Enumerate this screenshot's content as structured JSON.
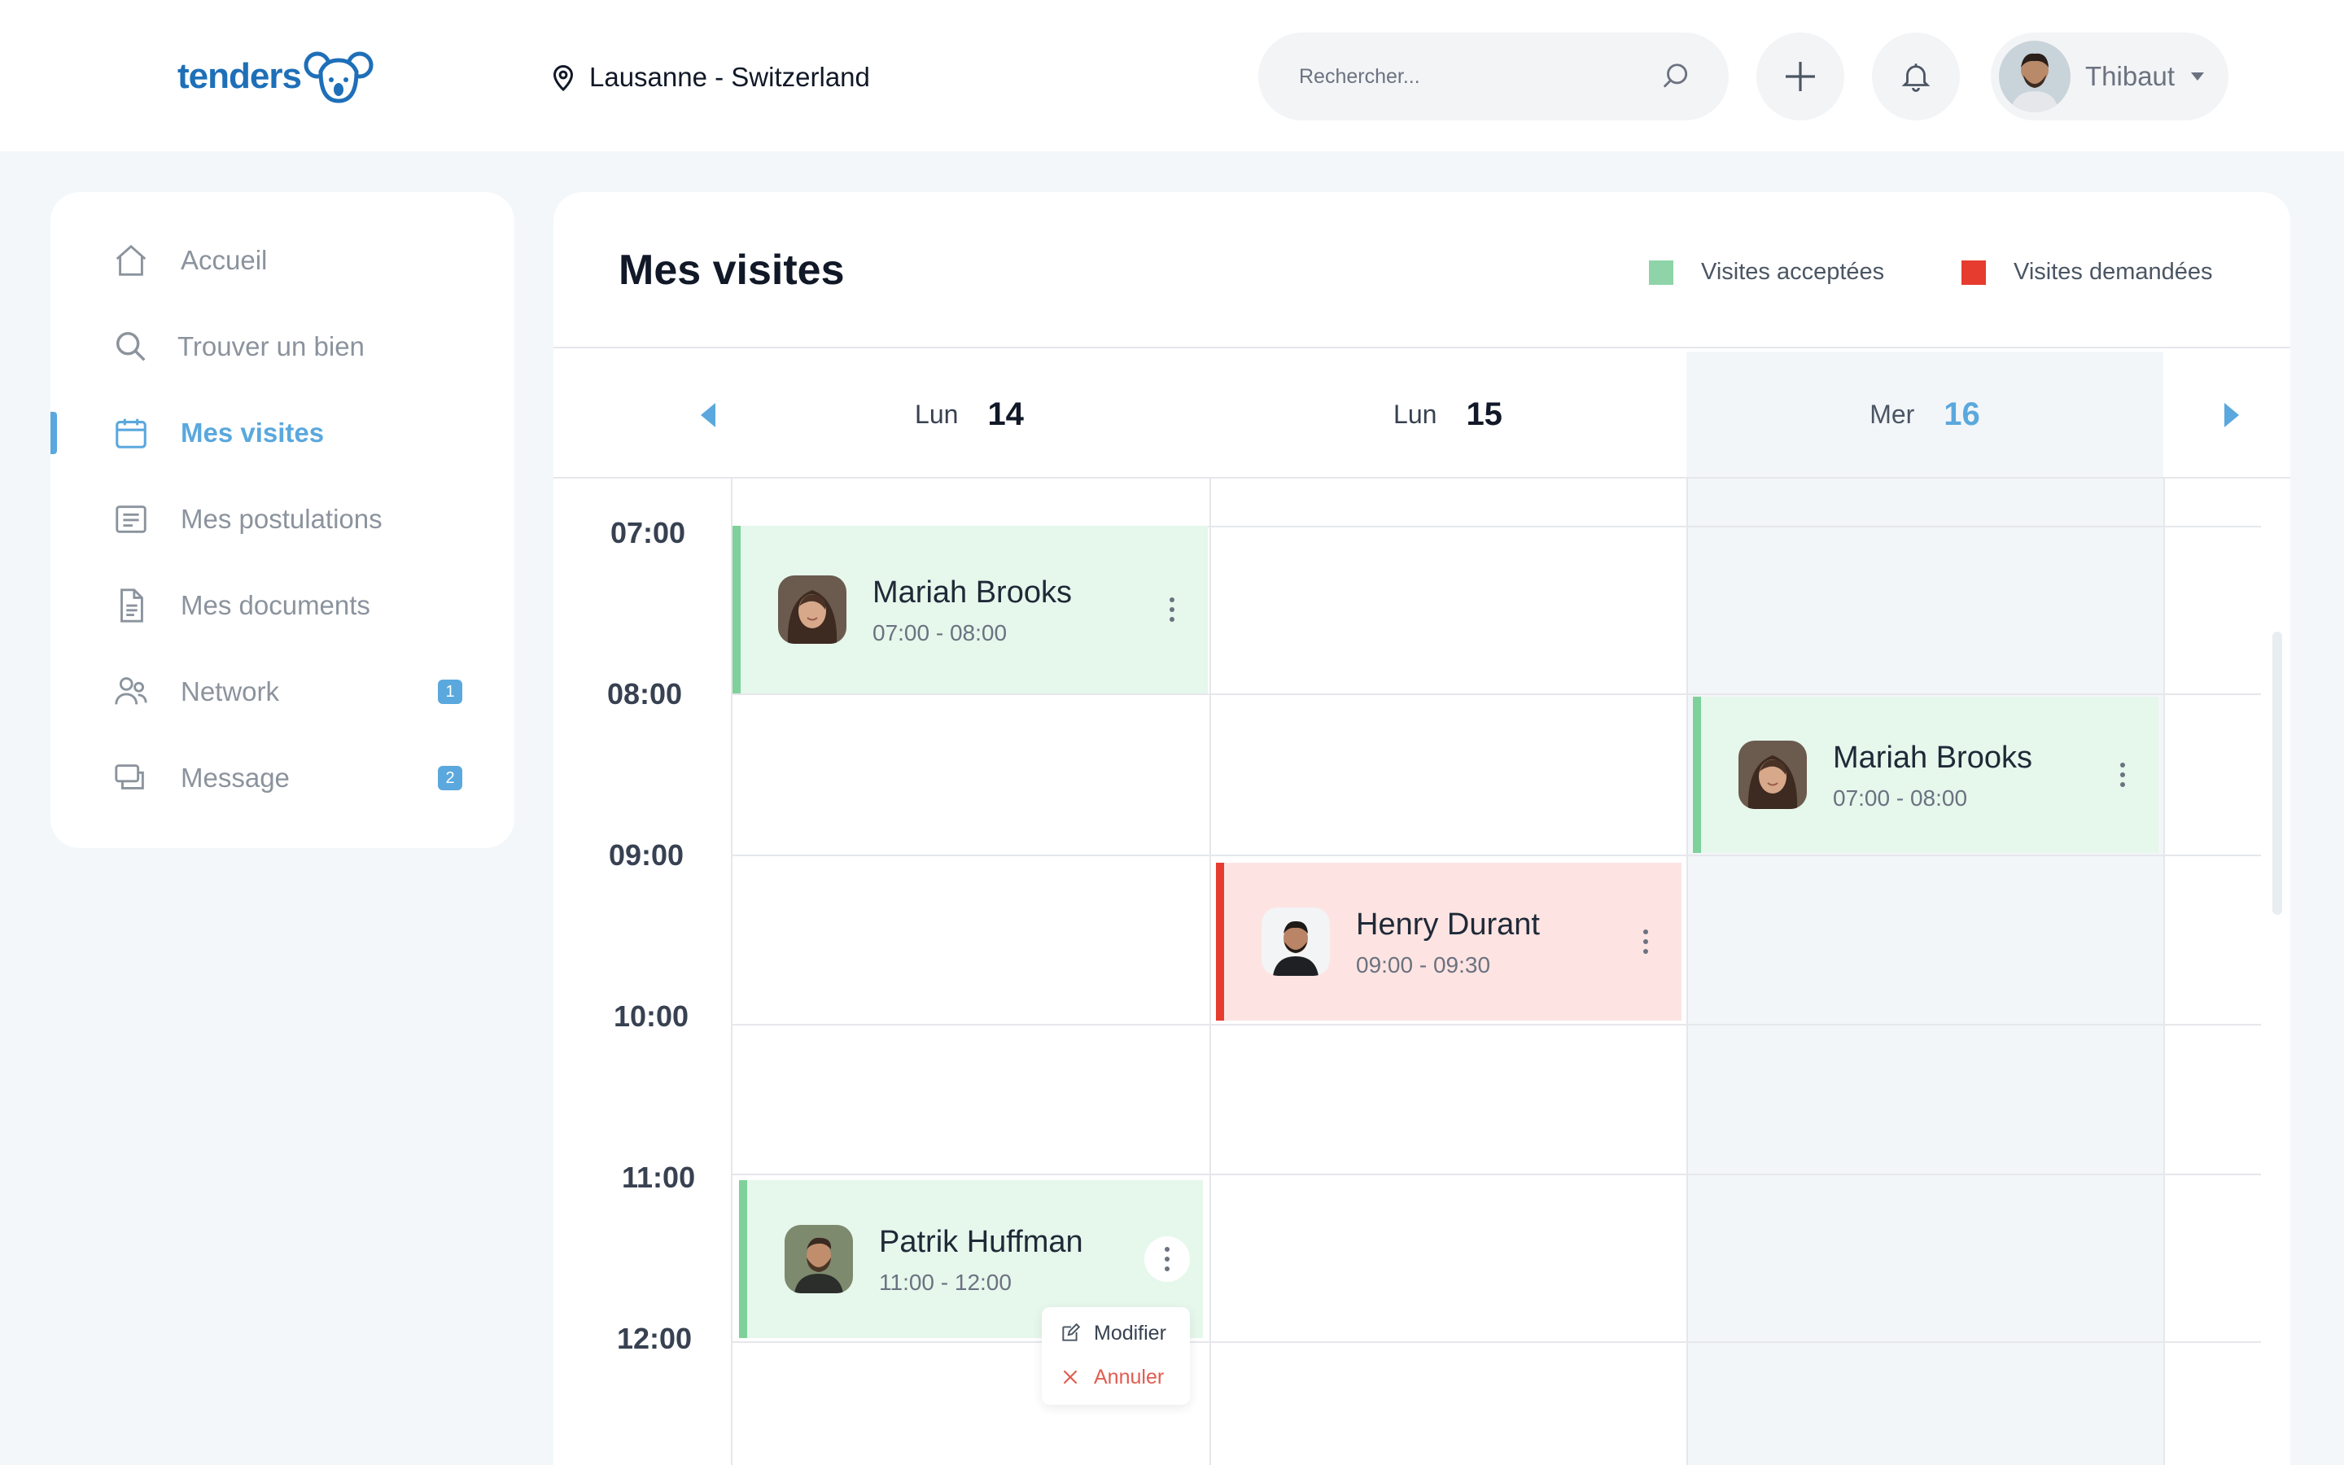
{
  "app": {
    "brand": "tenders",
    "location": "Lausanne - Switzerland"
  },
  "header": {
    "search_placeholder": "Rechercher...",
    "user_name": "Thibaut"
  },
  "sidebar": {
    "items": [
      {
        "label": "Accueil",
        "icon": "home-icon"
      },
      {
        "label": "Trouver un bien",
        "icon": "search-icon"
      },
      {
        "label": "Mes visites",
        "icon": "calendar-icon",
        "active": true
      },
      {
        "label": "Mes postulations",
        "icon": "list-icon"
      },
      {
        "label": "Mes documents",
        "icon": "document-icon"
      },
      {
        "label": "Network",
        "icon": "users-icon",
        "badge": "1"
      },
      {
        "label": "Message",
        "icon": "chat-icon",
        "badge": "2"
      }
    ]
  },
  "main": {
    "title": "Mes visites",
    "legend": {
      "accepted": "Visites acceptées",
      "requested": "Visites demandées"
    },
    "days": [
      {
        "name": "Lun",
        "num": "14"
      },
      {
        "name": "Lun",
        "num": "15"
      },
      {
        "name": "Mer",
        "num": "16",
        "selected": true
      }
    ],
    "times": [
      "07:00",
      "08:00",
      "09:00",
      "10:00",
      "11:00",
      "12:00"
    ],
    "events": [
      {
        "name": "Mariah Brooks",
        "time": "07:00 - 08:00",
        "status": "accepted"
      },
      {
        "name": "Mariah Brooks",
        "time": "07:00 - 08:00",
        "status": "accepted"
      },
      {
        "name": "Henry Durant",
        "time": "09:00 - 09:30",
        "status": "requested"
      },
      {
        "name": "Patrik Huffman",
        "time": "11:00 - 12:00",
        "status": "accepted"
      }
    ],
    "context_menu": {
      "edit": "Modifier",
      "cancel": "Annuler"
    }
  },
  "colors": {
    "accent": "#5aa8dd",
    "brand": "#1e6fb8",
    "accepted": "#7fd19b",
    "accepted_bg": "#e6f7ec",
    "requested": "#e63c2f",
    "requested_bg": "#fde4e2"
  }
}
